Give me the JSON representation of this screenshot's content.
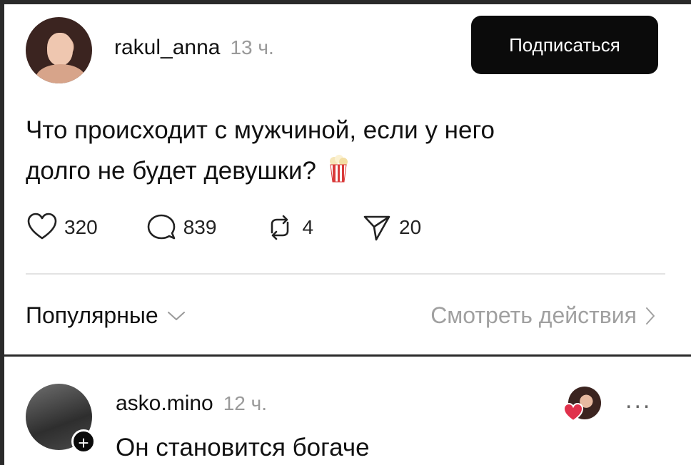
{
  "post": {
    "author": "rakul_anna",
    "time": "13 ч.",
    "follow_label": "Подписаться",
    "text_line1": "Что происходит с мужчиной, если у него",
    "text_line2": "долго не будет девушки?",
    "text_emoji": "popcorn-icon",
    "actions": {
      "likes": "320",
      "comments": "839",
      "reposts": "4",
      "shares": "20"
    }
  },
  "thread": {
    "sort_label": "Популярные",
    "see_actions_label": "Смотреть действия"
  },
  "comment": {
    "author": "asko.mino",
    "time": "12 ч.",
    "text": "Он становится богаче",
    "more_label": "..."
  },
  "colors": {
    "follow_button_bg": "#0b0b0b",
    "muted_text": "#9a9a9a",
    "like_heart": "#e0314b"
  }
}
